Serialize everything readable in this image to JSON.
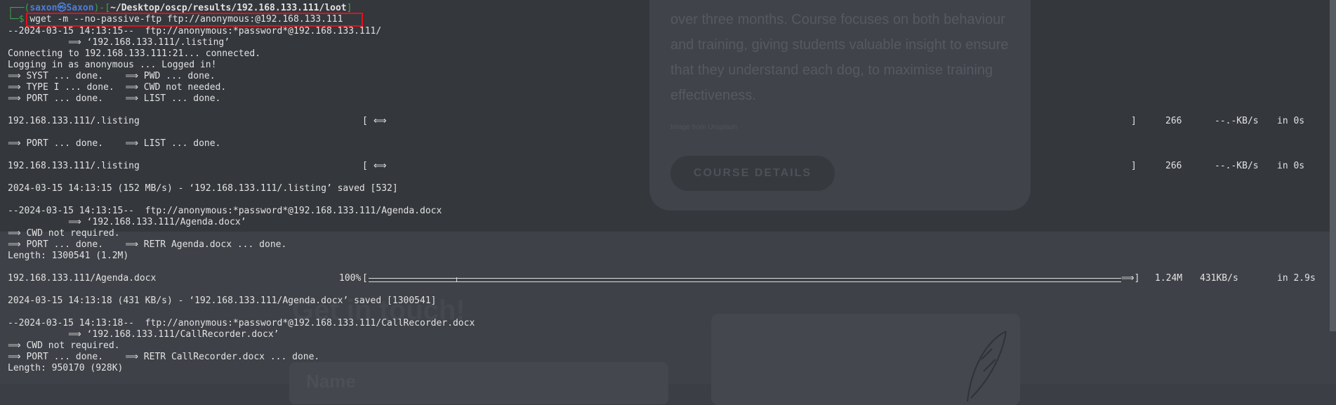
{
  "background_page": {
    "course_text": "over three months. Course focuses on both behaviour and training, giving students valuable insight to ensure that they understand each dog, to maximise training effectiveness.",
    "credit": "Image from Unsplash",
    "course_button": "COURSE DETAILS",
    "heading": "Get in touch!",
    "form_label": "Name"
  },
  "prompt": {
    "box_open": "┌──(",
    "user": "saxon㉿Saxon",
    "sep": ")-[",
    "path": "~/Desktop/oscp/results/192.168.133.111/loot",
    "box_close": "]",
    "second": "└─$ ",
    "command": "wget -m --no-passive-ftp ftp://anonymous:@192.168.133.111"
  },
  "lines": [
    "--2024-03-15 14:13:15--  ftp://anonymous:*password*@192.168.133.111/",
    "           ⟹ ‘192.168.133.111/.listing’",
    "Connecting to 192.168.133.111:21... connected.",
    "Logging in as anonymous ... Logged in!",
    "⟹ SYST ... done.    ⟹ PWD ... done.",
    "⟹ TYPE I ... done.  ⟹ CWD not needed.",
    "⟹ PORT ... done.    ⟹ LIST ... done.",
    "⟹ PORT ... done.    ⟹ LIST ... done.",
    "2024-03-15 14:13:15 (152 MB/s) - ‘192.168.133.111/.listing’ saved [532]",
    "--2024-03-15 14:13:15--  ftp://anonymous:*password*@192.168.133.111/Agenda.docx",
    "           ⟹ ‘192.168.133.111/Agenda.docx’",
    "⟹ CWD not required.",
    "⟹ PORT ... done.    ⟹ RETR Agenda.docx ... done.",
    "Length: 1300541 (1.2M)",
    "2024-03-15 14:13:18 (431 KB/s) - ‘192.168.133.111/Agenda.docx’ saved [1300541]",
    "--2024-03-15 14:13:18--  ftp://anonymous:*password*@192.168.133.111/CallRecorder.docx",
    "           ⟹ ‘192.168.133.111/CallRecorder.docx’",
    "⟹ CWD not required.",
    "⟹ PORT ... done.    ⟹ RETR CallRecorder.docx ... done.",
    "Length: 950170 (928K)"
  ],
  "transfers": [
    {
      "name": "192.168.133.111/.listing",
      "percent": "",
      "open": "[",
      "indicator": "⟺",
      "close": "]",
      "size": "266",
      "rate": "--.-KB/s",
      "time": "in 0s"
    },
    {
      "name": "192.168.133.111/.listing",
      "percent": "",
      "open": "[",
      "indicator": "⟺",
      "close": "]",
      "size": "266",
      "rate": "--.-KB/s",
      "time": "in 0s"
    },
    {
      "name": "192.168.133.111/Agenda.docx",
      "percent": "100%",
      "open": "[",
      "indicator": "",
      "close": "⟹]",
      "size": "1.24M",
      "rate": "431KB/s",
      "time": "in 2.9s",
      "progress": 1.0
    }
  ],
  "colors": {
    "prompt_box": "#3fa34d",
    "prompt_user": "#4d7fd6",
    "highlight": "#e0121b"
  }
}
